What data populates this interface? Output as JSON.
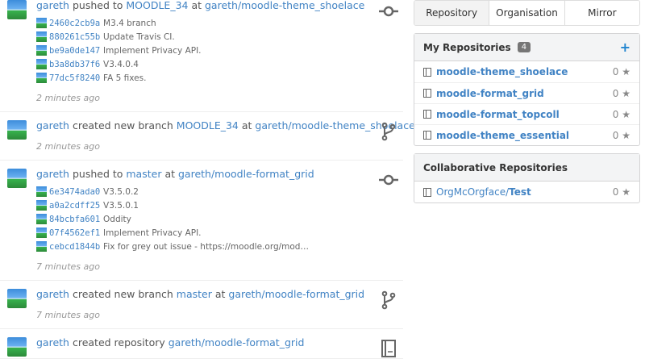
{
  "feed": [
    {
      "user": "gareth",
      "action_pre": " pushed to ",
      "ref": "MOODLE_34",
      "action_mid": " at ",
      "repo": "gareth/moodle-theme_shoelace",
      "icon": "commit-icon",
      "commits": [
        {
          "sha": "2460c2cb9a",
          "msg": "M3.4 branch"
        },
        {
          "sha": "880261c55b",
          "msg": "Update Travis CI."
        },
        {
          "sha": "be9a0de147",
          "msg": "Implement Privacy API."
        },
        {
          "sha": "b3a8db37f6",
          "msg": "V3.4.0.4"
        },
        {
          "sha": "77dc5f8240",
          "msg": "FA 5 fixes."
        }
      ],
      "time": "2 minutes ago"
    },
    {
      "user": "gareth",
      "action_pre": " created new branch ",
      "ref": "MOODLE_34",
      "action_mid": " at ",
      "repo": "gareth/moodle-theme_shoelace",
      "icon": "branch-icon",
      "commits": [],
      "time": "2 minutes ago"
    },
    {
      "user": "gareth",
      "action_pre": " pushed to ",
      "ref": "master",
      "action_mid": " at ",
      "repo": "gareth/moodle-format_grid",
      "icon": "commit-icon",
      "commits": [
        {
          "sha": "6e3474ada0",
          "msg": "V3.5.0.2"
        },
        {
          "sha": "a0a2cdff25",
          "msg": "V3.5.0.1"
        },
        {
          "sha": "84bcbfa601",
          "msg": "Oddity"
        },
        {
          "sha": "07f4562ef1",
          "msg": "Implement Privacy API."
        },
        {
          "sha": "cebcd1844b",
          "msg": "Fix for grey out issue - https://moodle.org/mod…"
        }
      ],
      "time": "7 minutes ago"
    },
    {
      "user": "gareth",
      "action_pre": " created new branch ",
      "ref": "master",
      "action_mid": " at ",
      "repo": "gareth/moodle-format_grid",
      "icon": "branch-icon",
      "commits": [],
      "time": "7 minutes ago"
    },
    {
      "user": "gareth",
      "action_pre": " created repository ",
      "ref": "",
      "action_mid": "",
      "repo": "gareth/moodle-format_grid",
      "icon": "book-icon",
      "commits": [],
      "time": ""
    }
  ],
  "tabs": [
    "Repository",
    "Organisation",
    "Mirror"
  ],
  "my_repos": {
    "title": "My Repositories",
    "count": "4",
    "add_label": "+",
    "items": [
      {
        "name": "moodle-theme_shoelace",
        "stars": "0"
      },
      {
        "name": "moodle-format_grid",
        "stars": "0"
      },
      {
        "name": "moodle-format_topcoll",
        "stars": "0"
      },
      {
        "name": "moodle-theme_essential",
        "stars": "0"
      }
    ]
  },
  "collab_repos": {
    "title": "Collaborative Repositories",
    "items": [
      {
        "owner": "OrgMcOrgface",
        "sep": " / ",
        "name": "Test",
        "stars": "0"
      }
    ]
  },
  "star_glyph": "★",
  "colors": {
    "link": "#4183c4",
    "accent": "#2185d0"
  }
}
